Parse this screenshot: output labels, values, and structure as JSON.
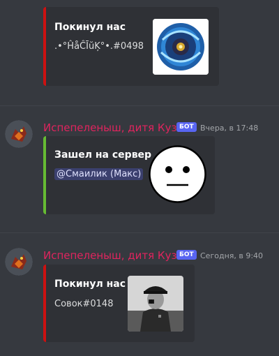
{
  "colors": {
    "background": "#36393f",
    "embed_background": "#2f3136",
    "leave_bar": "#cc1111",
    "join_bar": "#66bb33",
    "username": "#e0245e",
    "bot_tag": "#5865f2"
  },
  "messages": [
    {
      "embed": {
        "title": "Покинул нас",
        "description": ".•°ĤåĈĪŭĶ°•.#0498",
        "thumbnail": "blue-orb-emblem"
      }
    },
    {
      "author": "Испепеленыш, дитя Кузни",
      "bot_tag": "БОТ",
      "timestamp": "Вчера, в 17:48",
      "embed": {
        "title": "Зашел на сервер",
        "mention": "@Смаилик (Макс)",
        "thumbnail": "neutral-face"
      }
    },
    {
      "author": "Испепеленыш, дитя Кузни",
      "bot_tag": "БОТ",
      "timestamp": "Сегодня, в 9:40",
      "embed": {
        "title": "Покинул нас",
        "description": "Совок#0148",
        "thumbnail": "bw-photo-soldier"
      }
    }
  ]
}
